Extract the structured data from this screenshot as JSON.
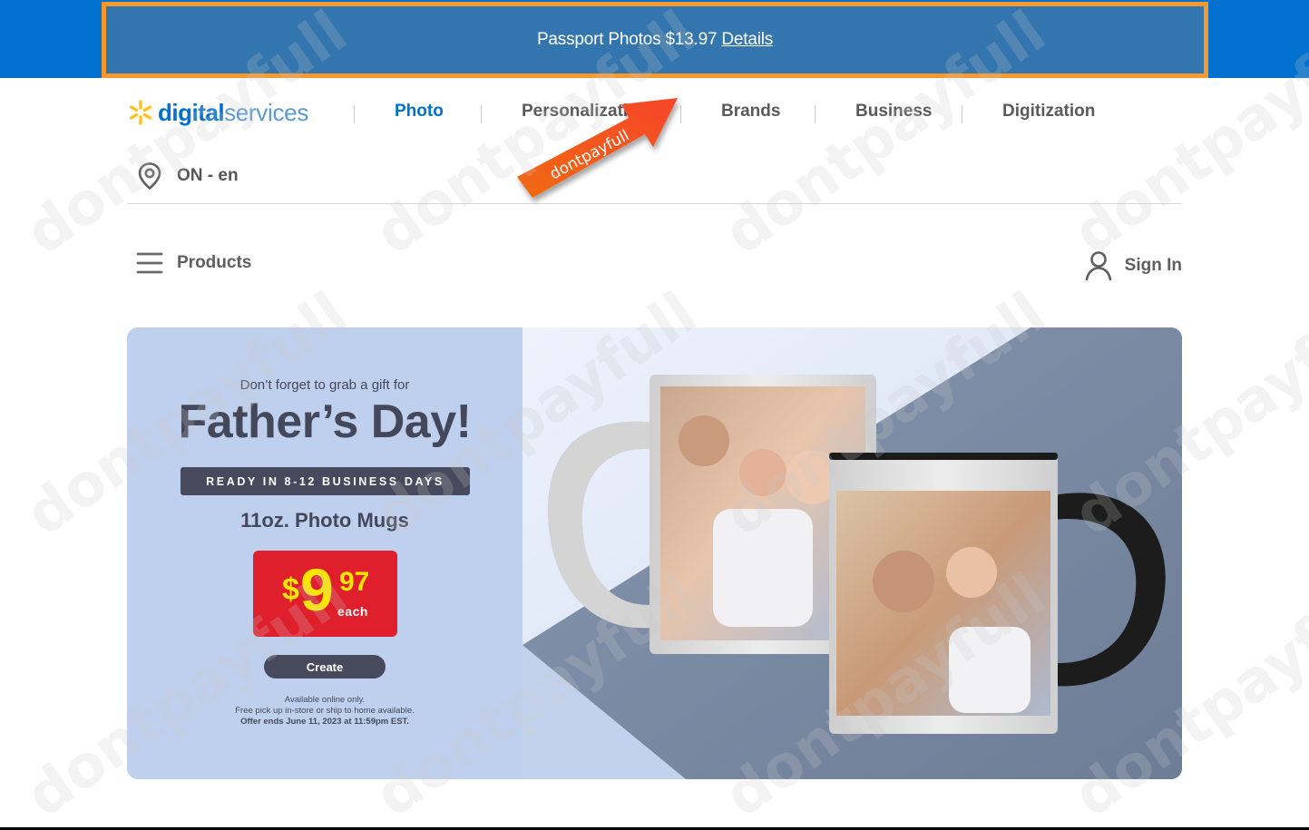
{
  "promo": {
    "text": "Passport Photos $13.97",
    "link_label": "Details"
  },
  "header": {
    "logo": {
      "bold": "digital",
      "light": "services"
    },
    "nav": [
      {
        "label": "Photo",
        "active": true
      },
      {
        "label": "Personalizati",
        "active": false
      },
      {
        "label": "Brands",
        "active": false
      },
      {
        "label": "Business",
        "active": false
      },
      {
        "label": "Digitization",
        "active": false
      }
    ],
    "locale": "ON - en",
    "overlay_arrow_text": "dontpayfull"
  },
  "subbar": {
    "products_label": "Products",
    "signin_label": "Sign In"
  },
  "hero": {
    "tagline": "Don’t forget to grab a gift for",
    "headline": "Father’s Day!",
    "ready_badge": "READY IN 8-12 BUSINESS DAYS",
    "product_name": "11oz. Photo Mugs",
    "price": {
      "currency": "$",
      "whole": "9",
      "cents": "97",
      "unit": "each"
    },
    "cta_label": "Create",
    "fineprint": [
      "Available online only.",
      "Free pick up in-store or ship to home available.",
      "Offer ends June 11, 2023 at 11:59pm EST."
    ],
    "image_alt": "Two photo mugs printed with family photos"
  },
  "watermark": "dontpayfull",
  "colors": {
    "brand_blue": "#0071ce",
    "promo_bg": "#3375ae",
    "promo_border": "#f7982e",
    "price_red": "#e01f2d",
    "price_yellow": "#ffe600",
    "spark_yellow": "#ffc220",
    "dark_slate": "#474a5c"
  }
}
